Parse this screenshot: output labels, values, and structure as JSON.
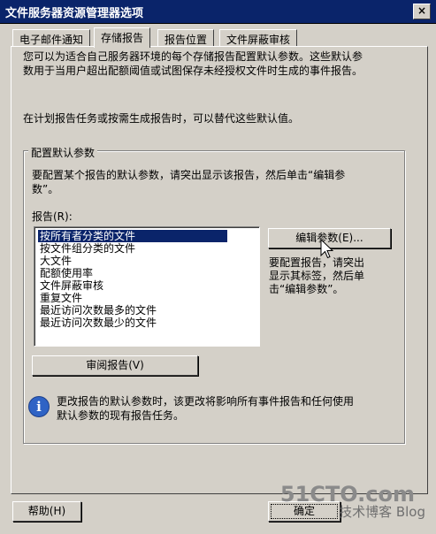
{
  "window": {
    "title": "文件服务器资源管理器选项",
    "close_label": "×"
  },
  "tabs": [
    {
      "label": "电子邮件通知",
      "active": false
    },
    {
      "label": "存储报告",
      "active": true
    },
    {
      "label": "报告位置",
      "active": false
    },
    {
      "label": "文件屏蔽审核",
      "active": false
    }
  ],
  "intro": {
    "line1": "您可以为适合自己服务器环境的每个存储报告配置默认参数。这些默认参",
    "line2": "数用于当用户超出配额阈值或试图保存未经授权文件时生成的事件报告。",
    "line3": "在计划报告任务或按需生成报告时，可以替代这些默认值。"
  },
  "group": {
    "legend": "配置默认参数",
    "desc1": "要配置某个报告的默认参数，请突出显示该报告，然后单击“编辑参",
    "desc2": "数”。",
    "list_label": "报告(R):",
    "reports": [
      "按所有者分类的文件",
      "按文件组分类的文件",
      "大文件",
      "配额使用率",
      "文件屏蔽审核",
      "重复文件",
      "最近访问次数最多的文件",
      "最近访问次数最少的文件"
    ],
    "selected_index": 0,
    "edit_button": "编辑参数(E)...",
    "edit_hint1": "要配置报告，请突出",
    "edit_hint2": "显示其标签，然后单",
    "edit_hint3": "击“编辑参数”。",
    "review_button": "审阅报告(V)",
    "info1": "更改报告的默认参数时，该更改将影响所有事件报告和任何使用",
    "info2": "默认参数的现有报告任务。"
  },
  "footer": {
    "help_button": "帮助(H)",
    "ok_button": "确定"
  },
  "watermark": {
    "line1": "51CTO.com",
    "line2": "技术博客 Blog"
  },
  "colors": {
    "title_bar": "#0a246a",
    "selection": "#0a246a",
    "face": "#d4d0c8"
  }
}
